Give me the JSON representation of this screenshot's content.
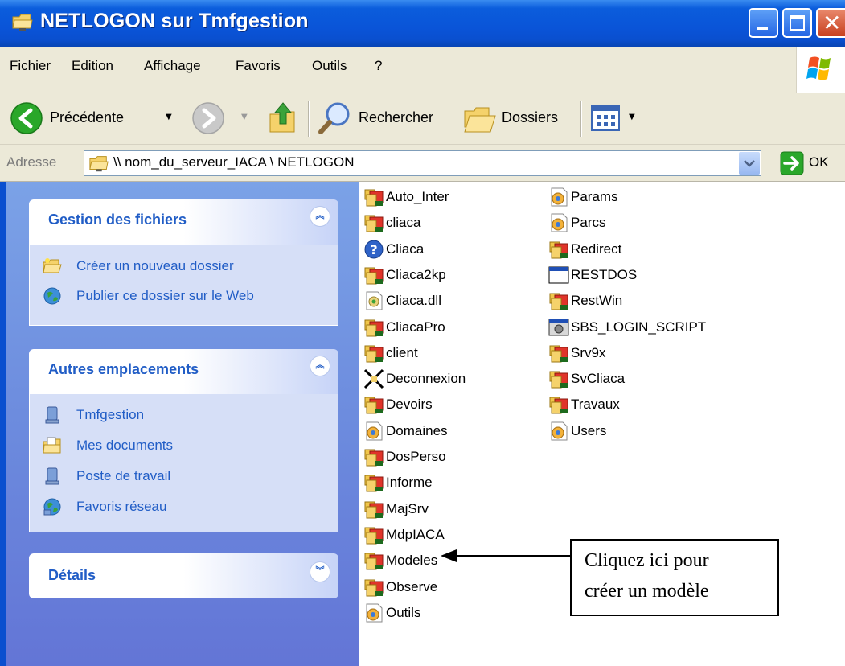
{
  "window": {
    "title": "NETLOGON sur Tmfgestion",
    "icon": "network-folder-icon",
    "controls": [
      "minimize-icon",
      "maximize-icon",
      "close-icon"
    ]
  },
  "menu": [
    "Fichier",
    "Edition",
    "Affichage",
    "Favoris",
    "Outils",
    "?"
  ],
  "toolbar": {
    "back_label": "Précédente",
    "search_label": "Rechercher",
    "folders_label": "Dossiers"
  },
  "address": {
    "label": "Adresse",
    "value": "\\\\ nom_du_serveur_IACA \\ NETLOGON",
    "go_label": "OK"
  },
  "task_pane": {
    "file_tasks": {
      "title": "Gestion des fichiers",
      "links": [
        "Créer un nouveau dossier",
        "Publier ce dossier sur le Web"
      ]
    },
    "other_places": {
      "title": "Autres emplacements",
      "links": [
        "Tmfgestion",
        "Mes documents",
        "Poste de travail",
        "Favoris réseau"
      ]
    },
    "details": {
      "title": "Détails"
    }
  },
  "files": {
    "column1": [
      {
        "name": "Auto_Inter",
        "icon": "shared-folder-icon"
      },
      {
        "name": "cliaca",
        "icon": "shared-folder-icon"
      },
      {
        "name": "Cliaca",
        "icon": "help-file-icon"
      },
      {
        "name": "Cliaca2kp",
        "icon": "shared-folder-icon"
      },
      {
        "name": "Cliaca.dll",
        "icon": "dll-file-icon"
      },
      {
        "name": "CliacaPro",
        "icon": "shared-folder-icon"
      },
      {
        "name": "client",
        "icon": "shared-folder-icon"
      },
      {
        "name": "Deconnexion",
        "icon": "disconnect-icon"
      },
      {
        "name": "Devoirs",
        "icon": "shared-folder-icon"
      },
      {
        "name": "Domaines",
        "icon": "config-file-icon"
      },
      {
        "name": "DosPerso",
        "icon": "shared-folder-icon"
      },
      {
        "name": "Informe",
        "icon": "shared-folder-icon"
      },
      {
        "name": "MajSrv",
        "icon": "shared-folder-icon"
      },
      {
        "name": "MdpIACA",
        "icon": "shared-folder-icon"
      },
      {
        "name": "Modeles",
        "icon": "shared-folder-icon"
      },
      {
        "name": "Observe",
        "icon": "shared-folder-icon"
      },
      {
        "name": "Outils",
        "icon": "config-file-icon"
      }
    ],
    "column2": [
      {
        "name": "Params",
        "icon": "config-file-icon"
      },
      {
        "name": "Parcs",
        "icon": "config-file-icon"
      },
      {
        "name": "Redirect",
        "icon": "shared-folder-icon"
      },
      {
        "name": "RESTDOS",
        "icon": "dos-window-icon"
      },
      {
        "name": "RestWin",
        "icon": "shared-folder-icon"
      },
      {
        "name": "SBS_LOGIN_SCRIPT",
        "icon": "batch-file-icon"
      },
      {
        "name": "Srv9x",
        "icon": "shared-folder-icon"
      },
      {
        "name": "SvCliaca",
        "icon": "shared-folder-icon"
      },
      {
        "name": "Travaux",
        "icon": "shared-folder-icon"
      },
      {
        "name": "Users",
        "icon": "config-file-icon"
      }
    ]
  },
  "annotation": {
    "line1": "Cliquez ici pour",
    "line2": "créer un modèle"
  },
  "colors": {
    "titlebar": "#0a54d8",
    "taskpane": "#6b89dd",
    "link": "#215dc6",
    "panel_body": "#d6dff7"
  }
}
